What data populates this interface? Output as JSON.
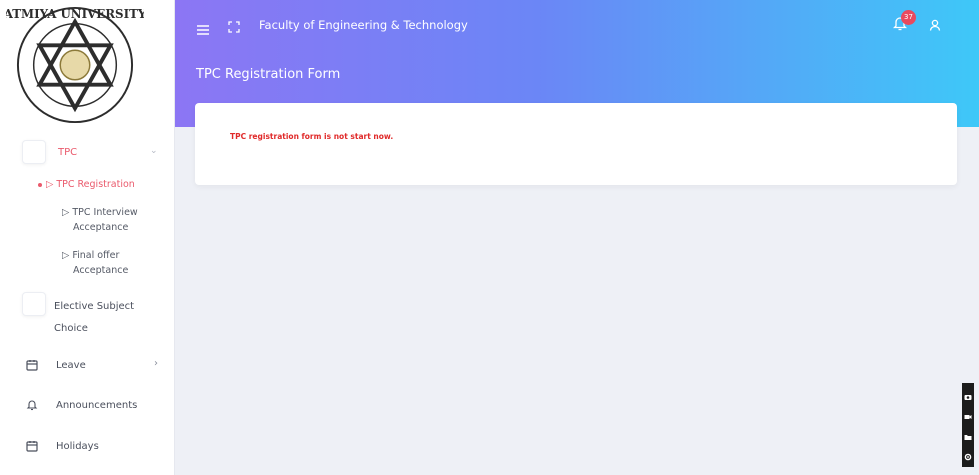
{
  "header": {
    "faculty": "Faculty of Engineering & Technology",
    "page_title": "TPC Registration Form",
    "notification_count": "37"
  },
  "logo": {
    "text_top": "ATMIYA UNIVERSITY"
  },
  "sidebar": {
    "tpc_label": "TPC",
    "sub_items": [
      {
        "label": "TPC Registration"
      },
      {
        "label_line1": "TPC Interview",
        "label_line2": "Acceptance"
      },
      {
        "label_line1": "Final offer",
        "label_line2": "Acceptance"
      }
    ],
    "elective_line1": "Elective Subject",
    "elective_line2": "Choice",
    "leave_label": "Leave",
    "announcements_label": "Announcements",
    "holidays_label": "Holidays"
  },
  "main": {
    "message": "TPC registration form is not start now."
  },
  "colors": {
    "accent": "#ea5a6c",
    "gradient_start": "#8c76f4",
    "gradient_end": "#3ec8f8",
    "error": "#e02a2a"
  }
}
